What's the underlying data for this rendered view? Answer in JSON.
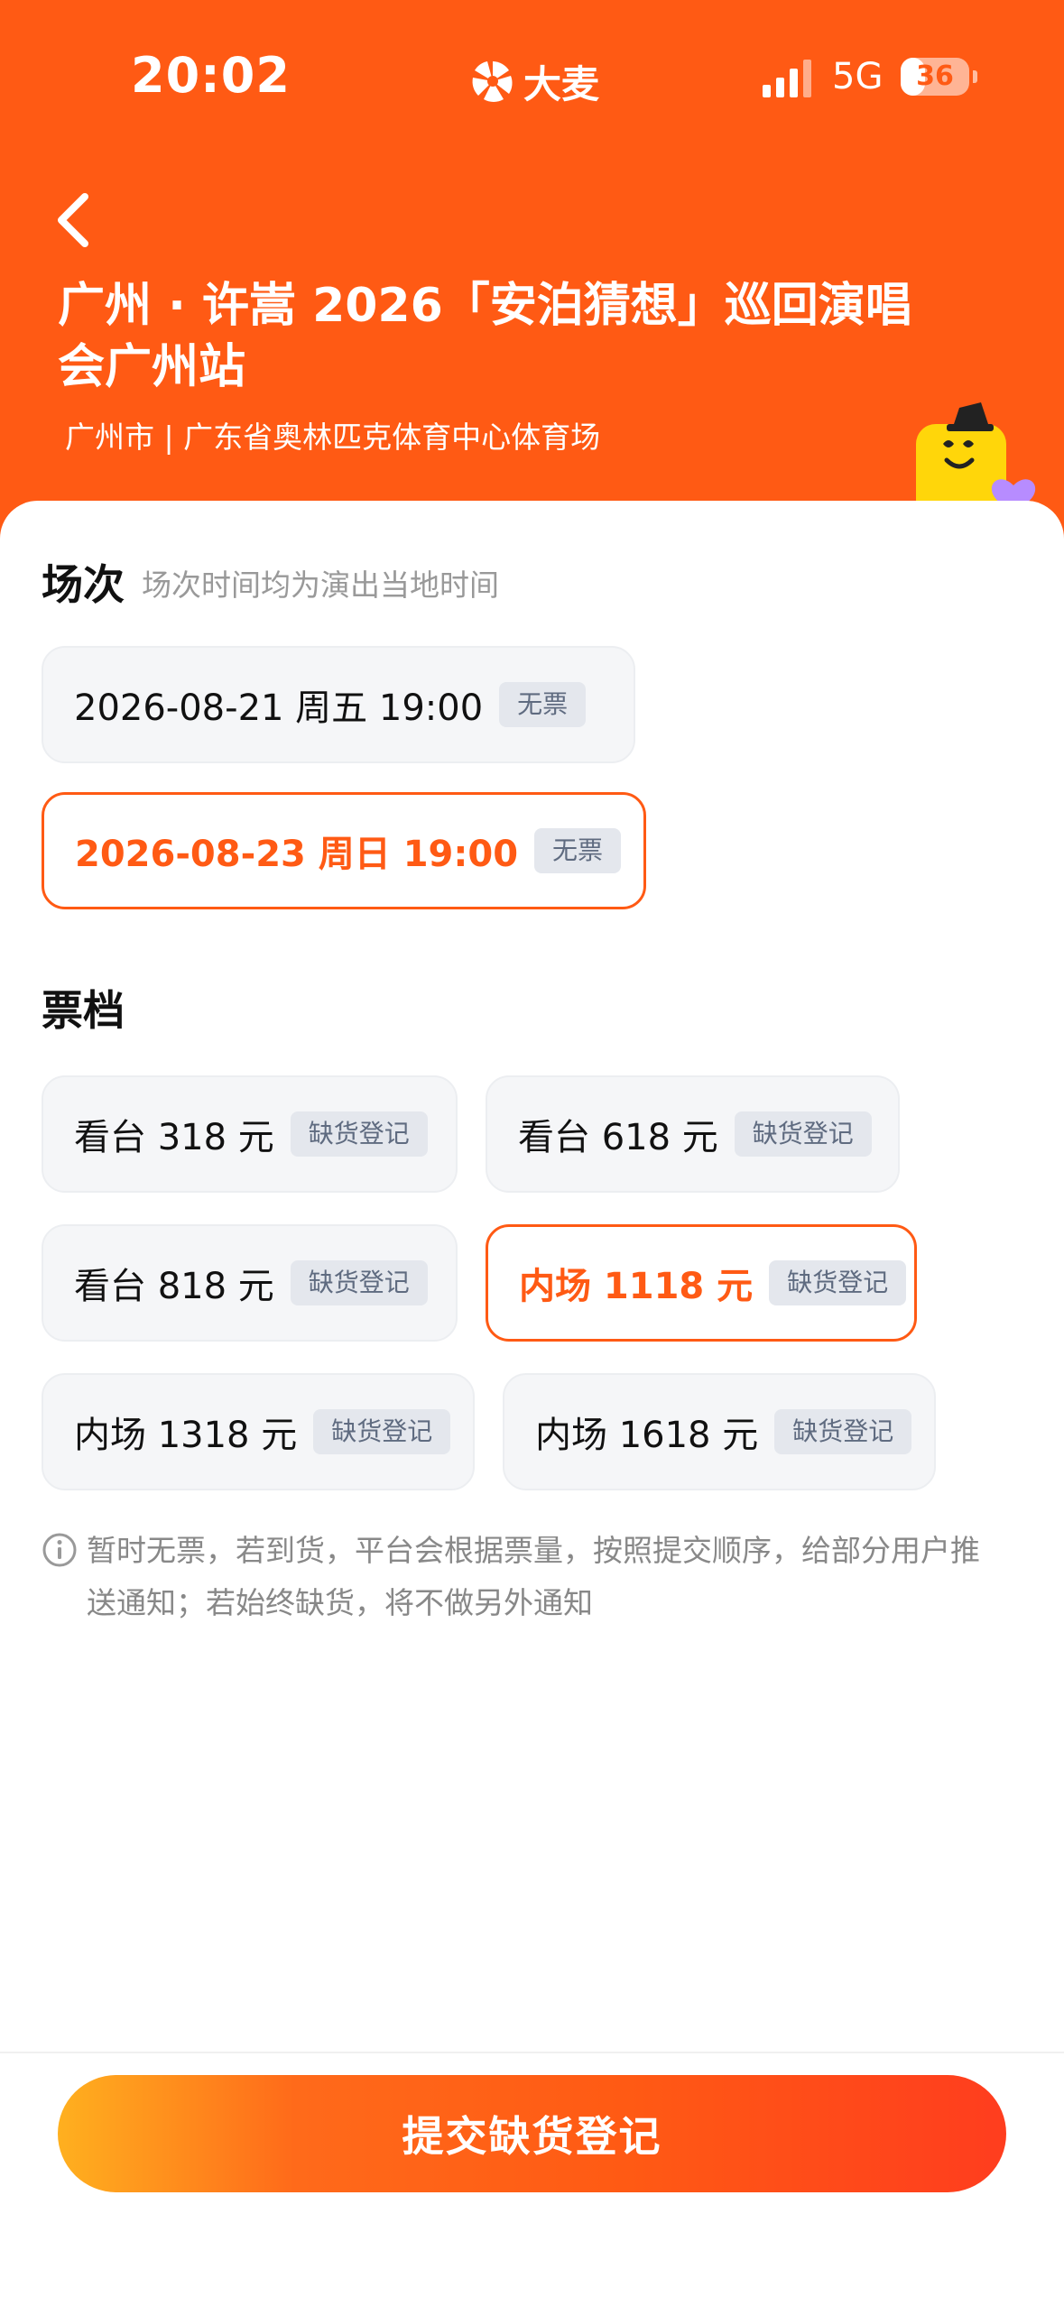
{
  "status_bar": {
    "time": "20:02",
    "brand": "大麦",
    "network": "5G",
    "battery": "36"
  },
  "header": {
    "title": "广州 · 许嵩 2026「安泊猜想」巡回演唱会广州站",
    "venue": "广州市 | 广东省奥林匹克体育中心体育场"
  },
  "sessions": {
    "title": "场次",
    "subtitle": "场次时间均为演出当地时间",
    "items": [
      {
        "label": "2026-08-21  周五 19:00",
        "badge": "无票"
      },
      {
        "label": "2026-08-23 周日 19:00",
        "badge": "无票",
        "selected": true
      }
    ]
  },
  "tickets": {
    "title": "票档",
    "items": [
      {
        "label": "看台 318 元",
        "badge": "缺货登记"
      },
      {
        "label": "看台 618 元",
        "badge": "缺货登记"
      },
      {
        "label": "看台 818 元",
        "badge": "缺货登记"
      },
      {
        "label": "内场 1118 元",
        "badge": "缺货登记",
        "selected": true
      },
      {
        "label": "内场 1318 元",
        "badge": "缺货登记"
      },
      {
        "label": "内场 1618 元",
        "badge": "缺货登记"
      }
    ]
  },
  "notice": "暂时无票，若到货，平台会根据票量，按照提交顺序，给部分用户推送通知；若始终缺货，将不做另外通知",
  "footer": {
    "submit_label": "提交缺货登记"
  },
  "colors": {
    "accent": "#ff5a14",
    "badge_bg": "#e4e7ed",
    "badge_text": "#5f6b80"
  }
}
